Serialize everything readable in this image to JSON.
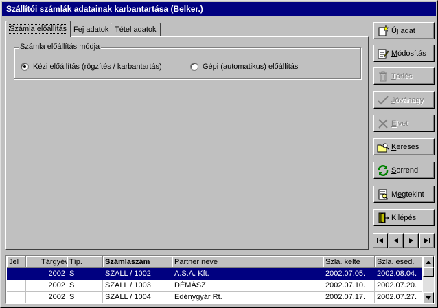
{
  "window": {
    "title": "Szállítói számlák adatainak karbantartása (Belker.)"
  },
  "tabs": [
    {
      "label": "Számla előállítás",
      "active": true
    },
    {
      "label": "Fej adatok",
      "active": false
    },
    {
      "label": "Tétel adatok",
      "active": false
    }
  ],
  "group": {
    "title": "Számla előállítás módja",
    "options": [
      {
        "label": "Kézi előállítás (rögzítés / karbantartás)",
        "selected": true
      },
      {
        "label": "Gépi (automatikus) előállítás",
        "selected": false
      }
    ]
  },
  "buttons": {
    "new": {
      "hotkey": "Ú",
      "rest": "j adat",
      "icon": "new-record-icon",
      "enabled": true
    },
    "edit": {
      "hotkey": "M",
      "rest": "ódosítás",
      "icon": "edit-record-icon",
      "enabled": true
    },
    "delete": {
      "hotkey": "T",
      "rest": "örlés",
      "icon": "trash-icon",
      "enabled": false
    },
    "approve": {
      "hotkey": "J",
      "rest": "óváhagy",
      "icon": "checkmark-icon",
      "enabled": false
    },
    "reject": {
      "hotkey": "E",
      "rest": "lvet",
      "icon": "cross-icon",
      "enabled": false
    },
    "search": {
      "hotkey": "K",
      "rest": "eresés",
      "icon": "search-folder-icon",
      "enabled": true
    },
    "sort": {
      "hotkey": "S",
      "rest": "orrend",
      "icon": "refresh-arrows-icon",
      "enabled": true
    },
    "view": {
      "pre": "M",
      "hotkey": "e",
      "rest": "gtekint",
      "icon": "preview-page-icon",
      "enabled": true
    },
    "exit": {
      "pre": "K",
      "hotkey": "i",
      "rest": "lépés",
      "icon": "exit-door-icon",
      "enabled": true
    }
  },
  "nav": [
    "first-record-icon",
    "prev-record-icon",
    "next-record-icon",
    "last-record-icon"
  ],
  "grid": {
    "columns": [
      "Jel",
      "Tárgyév",
      "Típ.",
      "Számlaszám",
      "Partner neve",
      "Szla. kelte",
      "Szla. esed."
    ],
    "rows": [
      {
        "jel": "",
        "year": "2002",
        "type": "S",
        "number": "SZALL / 1002",
        "partner": "A.S.A. Kft.",
        "issued": "2002.07.05.",
        "due": "2002.08.04.",
        "selected": true
      },
      {
        "jel": "",
        "year": "2002",
        "type": "S",
        "number": "SZALL / 1003",
        "partner": "DÉMÁSZ",
        "issued": "2002.07.10.",
        "due": "2002.07.20.",
        "selected": false
      },
      {
        "jel": "",
        "year": "2002",
        "type": "S",
        "number": "SZALL / 1004",
        "partner": "Edénygyár Rt.",
        "issued": "2002.07.17.",
        "due": "2002.07.27.",
        "selected": false
      }
    ]
  },
  "colors": {
    "titlebar": "#000080",
    "face": "#c0c0c0",
    "selection": "#000080"
  }
}
